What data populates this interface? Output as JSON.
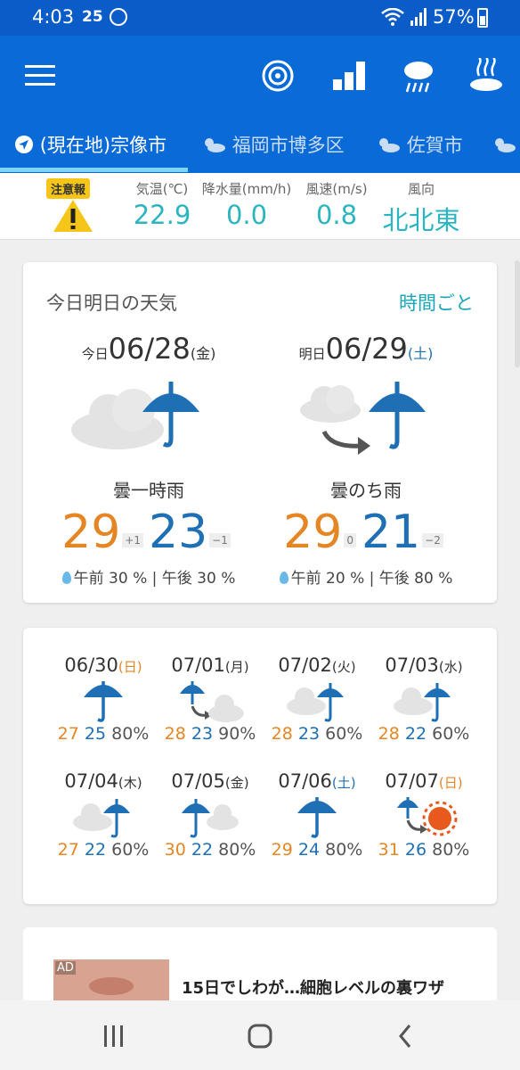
{
  "status_bar": {
    "time": "4:03",
    "temp_badge": "25",
    "battery": "57%"
  },
  "header": {
    "menu_icon": "hamburger-menu-icon",
    "actions": [
      {
        "name": "typhoon-icon"
      },
      {
        "name": "ranking-icon"
      },
      {
        "name": "rain-cloud-icon"
      },
      {
        "name": "onsen-icon"
      }
    ]
  },
  "tabs": [
    {
      "label": "(現在地)宗像市",
      "icon": "location-arrow-icon",
      "active": true
    },
    {
      "label": "福岡市博多区",
      "icon": "partly-cloudy-icon",
      "active": false
    },
    {
      "label": "佐賀市",
      "icon": "partly-cloudy-icon",
      "active": false
    }
  ],
  "observation": {
    "warning_badge": "注意報",
    "labels": [
      "気温(℃)",
      "降水量(mm/h)",
      "風速(m/s)",
      "風向"
    ],
    "values": [
      "22.9",
      "0.0",
      "0.8",
      "北北東"
    ]
  },
  "forecast": {
    "title": "今日明日の天気",
    "link": "時間ごと",
    "days": [
      {
        "prefix": "今日",
        "date": "06/28",
        "weekday": "(金)",
        "weather": "曇一時雨",
        "high": "29",
        "high_diff": "+1",
        "low": "23",
        "low_diff": "−1",
        "pop": "午前 30 %  |  午後 30 %"
      },
      {
        "prefix": "明日",
        "date": "06/29",
        "weekday": "(土)",
        "weather": "曇のち雨",
        "high": "29",
        "high_diff": "0",
        "low": "21",
        "low_diff": "−2",
        "pop": "午前 20 %  |  午後 80 %"
      }
    ]
  },
  "weekly": [
    {
      "date": "06/30",
      "weekday": "(日)",
      "high": "27",
      "low": "25",
      "pop": "80%",
      "icon": "umbrella-icon"
    },
    {
      "date": "07/01",
      "weekday": "(月)",
      "high": "28",
      "low": "23",
      "pop": "90%",
      "icon": "rain-then-cloud-icon"
    },
    {
      "date": "07/02",
      "weekday": "(火)",
      "high": "28",
      "low": "23",
      "pop": "60%",
      "icon": "cloud-rain-icon"
    },
    {
      "date": "07/03",
      "weekday": "(水)",
      "high": "28",
      "low": "22",
      "pop": "60%",
      "icon": "cloud-rain-icon"
    },
    {
      "date": "07/04",
      "weekday": "(木)",
      "high": "27",
      "low": "22",
      "pop": "60%",
      "icon": "cloud-rain-icon"
    },
    {
      "date": "07/05",
      "weekday": "(金)",
      "high": "30",
      "low": "22",
      "pop": "80%",
      "icon": "rain-cloud-icon"
    },
    {
      "date": "07/06",
      "weekday": "(土)",
      "high": "29",
      "low": "24",
      "pop": "80%",
      "icon": "umbrella-icon"
    },
    {
      "date": "07/07",
      "weekday": "(日)",
      "high": "31",
      "low": "26",
      "pop": "80%",
      "icon": "rain-then-sun-icon"
    }
  ],
  "ad": {
    "tag": "AD",
    "title": "15日でしわが…細胞レベルの裏ワザ"
  },
  "colors": {
    "appbar": "#0a6ad8",
    "status": "#0a5dc9",
    "high": "#e58624",
    "low": "#1f6fb5",
    "obs": "#2cb5c0"
  }
}
